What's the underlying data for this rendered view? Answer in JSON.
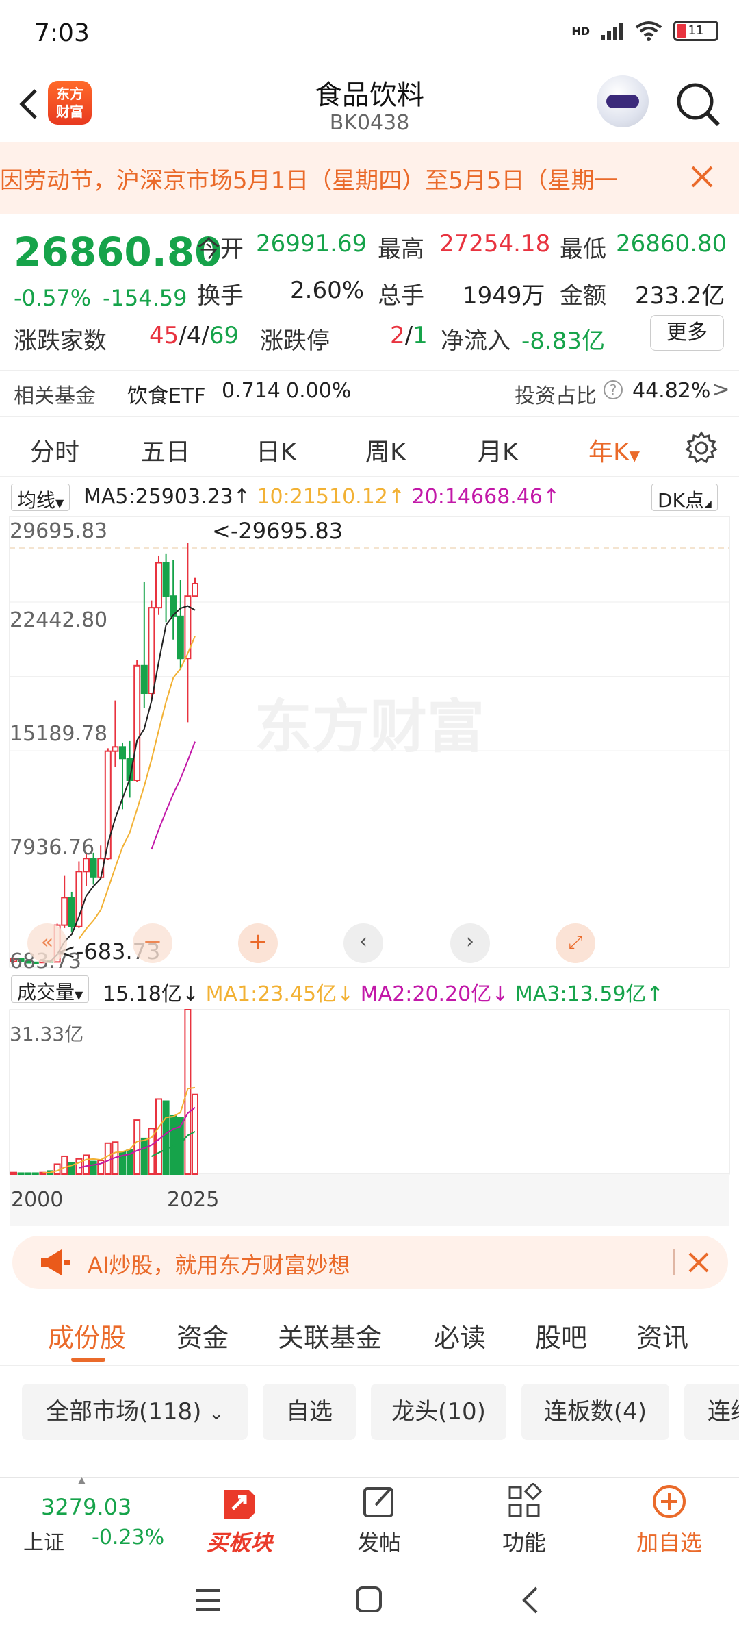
{
  "status": {
    "time": "7:03",
    "network": "HD",
    "battery": "11"
  },
  "header": {
    "title": "食品饮料",
    "code": "BK0438",
    "logo_text": "东方财富"
  },
  "notice": {
    "text": "因劳动节，沪深京市场5月1日（星期四）至5月5日（星期一"
  },
  "quote": {
    "price": "26860.80",
    "change_pct": "-0.57%",
    "change": "-154.59",
    "open_label": "今开",
    "open": "26991.69",
    "high_label": "最高",
    "high": "27254.18",
    "low_label": "最低",
    "low": "26860.80",
    "turnover_label": "换手",
    "turnover": "2.60%",
    "volume_label": "总手",
    "volume": "1949万",
    "amount_label": "金额",
    "amount": "233.2亿",
    "breadth_label": "涨跌家数",
    "breadth_up": "45",
    "breadth_flat": "4",
    "breadth_down": "69",
    "limit_label": "涨跌停",
    "limit_up": "2",
    "limit_down": "1",
    "inflow_label": "净流入",
    "inflow": "-8.83亿",
    "more_label": "更多"
  },
  "fund": {
    "label": "相关基金",
    "name": "饮食ETF",
    "price": "0.714",
    "change": "0.00%",
    "ratio_label": "投资占比",
    "ratio": "44.82%"
  },
  "period_tabs": [
    "分时",
    "五日",
    "日K",
    "周K",
    "月K",
    "年K"
  ],
  "chart": {
    "ma_selector": "均线",
    "ma5": "MA5:25903.23",
    "ma10": "10:21510.12",
    "ma20": "20:14668.46",
    "dk_label": "DK点",
    "y_labels": [
      "29695.83",
      "22442.80",
      "15189.78",
      "7936.76",
      "683.73"
    ],
    "high_marker": "<-29695.83",
    "low_marker": "<-683.73",
    "watermark": "东方财富",
    "vol_selector": "成交量",
    "vol_value": "15.18亿",
    "ma1": "MA1:23.45亿",
    "ma2": "MA2:20.20亿",
    "ma3": "MA3:13.59亿",
    "vol_max": "31.33亿",
    "x_labels": [
      "2000",
      "2025"
    ],
    "colors": {
      "up": "#e8333f",
      "down": "#16a34a",
      "ma5": "#222222",
      "ma10": "#f2b134",
      "ma20": "#c218a8"
    }
  },
  "chart_data": {
    "type": "candlestick",
    "title": "",
    "x": [
      2000,
      2001,
      2002,
      2003,
      2004,
      2005,
      2006,
      2007,
      2008,
      2009,
      2010,
      2011,
      2012,
      2013,
      2014,
      2015,
      2016,
      2017,
      2018,
      2019,
      2020,
      2021,
      2022,
      2023,
      2024,
      2025
    ],
    "ohlc": [
      [
        800,
        1050,
        683.73,
        980
      ],
      [
        980,
        1000,
        760,
        800
      ],
      [
        800,
        880,
        700,
        740
      ],
      [
        740,
        760,
        683.73,
        720
      ],
      [
        720,
        900,
        700,
        860
      ],
      [
        860,
        900,
        700,
        760
      ],
      [
        760,
        3400,
        740,
        3300
      ],
      [
        3300,
        6700,
        3100,
        5200
      ],
      [
        5200,
        5600,
        2800,
        3200
      ],
      [
        3200,
        7700,
        3100,
        7000
      ],
      [
        7000,
        8200,
        6000,
        7900
      ],
      [
        7900,
        8300,
        6100,
        6600
      ],
      [
        6600,
        8800,
        6500,
        7900
      ],
      [
        7900,
        15500,
        7800,
        15300
      ],
      [
        15300,
        18800,
        14200,
        15600
      ],
      [
        15600,
        15900,
        11300,
        14800
      ],
      [
        14800,
        16000,
        12100,
        13300
      ],
      [
        13300,
        21600,
        13200,
        21200
      ],
      [
        21200,
        27000,
        18300,
        19300
      ],
      [
        19300,
        25700,
        18800,
        25200
      ],
      [
        25200,
        28800,
        24700,
        28300
      ],
      [
        28300,
        28900,
        24200,
        26000
      ],
      [
        26000,
        28500,
        23000,
        24600
      ],
      [
        24600,
        27100,
        20900,
        21700
      ],
      [
        21700,
        29695.83,
        17300,
        26000
      ],
      [
        26000,
        27254.18,
        26860.8,
        26860.8
      ]
    ],
    "volume": [
      0.3,
      0.2,
      0.2,
      0.2,
      0.3,
      0.6,
      1.9,
      3.4,
      2.1,
      2.9,
      3.6,
      2.4,
      2.6,
      5.9,
      6.1,
      4.3,
      4.6,
      10.3,
      6.8,
      8.7,
      14.3,
      13.9,
      11.1,
      10.8,
      31.33,
      15.18
    ],
    "ylim": [
      683.73,
      29695.83
    ],
    "vol_ylim": [
      0,
      31.33
    ]
  },
  "ad": {
    "text": "AI炒股，就用东方财富妙想"
  },
  "section_tabs": [
    "成份股",
    "资金",
    "关联基金",
    "必读",
    "股吧",
    "资讯"
  ],
  "filters": [
    "全部市场(118)",
    "自选",
    "龙头(10)",
    "连板数(4)",
    "连续"
  ],
  "bottom": {
    "index_value": "3279.03",
    "index_name": "上证",
    "index_change": "-0.23%",
    "buy_label": "买板块",
    "post_label": "发帖",
    "func_label": "功能",
    "add_label": "加自选"
  }
}
